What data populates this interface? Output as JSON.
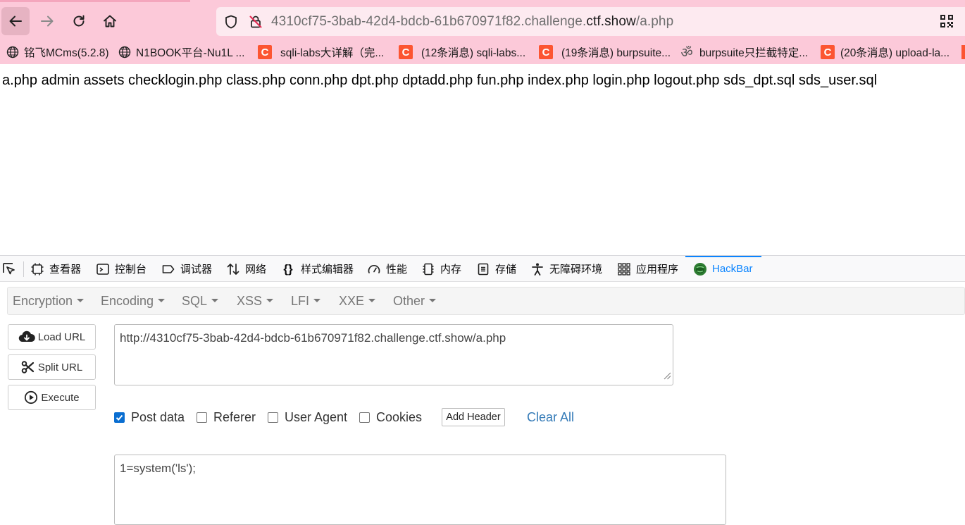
{
  "browser": {
    "url_prefix": "4310cf75-3bab-42d4-bdcb-61b670971f82.challenge.",
    "url_domain": "ctf.show",
    "url_path": "/a.php"
  },
  "bookmarks": [
    {
      "label": "铭飞MCms(5.2.8)",
      "icon": "globe-icon"
    },
    {
      "label": "N1BOOK平台-Nu1L ...",
      "icon": "globe-icon"
    },
    {
      "label": "sqli-labs大详解（完...",
      "icon": "csdn-icon"
    },
    {
      "label": "(12条消息) sqli-labs...",
      "icon": "csdn-icon"
    },
    {
      "label": "(19条消息) burpsuite...",
      "icon": "csdn-icon"
    },
    {
      "label": "burpsuite只拦截特定...",
      "icon": "om-icon"
    },
    {
      "label": "(20条消息) upload-la...",
      "icon": "csdn-icon"
    }
  ],
  "page": {
    "output": "a.php admin assets checklogin.php class.php conn.php dpt.php dptadd.php fun.php index.php login.php logout.php sds_dpt.sql sds_user.sql"
  },
  "devtools": {
    "tabs": [
      {
        "label": "查看器",
        "icon": "inspector-icon"
      },
      {
        "label": "控制台",
        "icon": "console-icon"
      },
      {
        "label": "调试器",
        "icon": "debugger-icon"
      },
      {
        "label": "网络",
        "icon": "network-icon"
      },
      {
        "label": "样式编辑器",
        "icon": "style-editor-icon"
      },
      {
        "label": "性能",
        "icon": "performance-icon"
      },
      {
        "label": "内存",
        "icon": "memory-icon"
      },
      {
        "label": "存储",
        "icon": "storage-icon"
      },
      {
        "label": "无障碍环境",
        "icon": "accessibility-icon"
      },
      {
        "label": "应用程序",
        "icon": "application-icon"
      },
      {
        "label": "HackBar",
        "icon": "hackbar-icon",
        "active": true
      }
    ],
    "accent": "#0a84ff"
  },
  "hackbar": {
    "menu": [
      "Encryption",
      "Encoding",
      "SQL",
      "XSS",
      "LFI",
      "XXE",
      "Other"
    ],
    "buttons": {
      "load_url": "Load URL",
      "split_url": "Split URL",
      "execute": "Execute"
    },
    "url_value": "http://4310cf75-3bab-42d4-bdcb-61b670971f82.challenge.ctf.show/a.php",
    "options": {
      "post_data": {
        "label": "Post data",
        "checked": true
      },
      "referer": {
        "label": "Referer",
        "checked": false
      },
      "user_agent": {
        "label": "User Agent",
        "checked": false
      },
      "cookies": {
        "label": "Cookies",
        "checked": false
      }
    },
    "add_header": "Add Header",
    "clear_all": "Clear All",
    "post_value": "1=system('ls');"
  }
}
